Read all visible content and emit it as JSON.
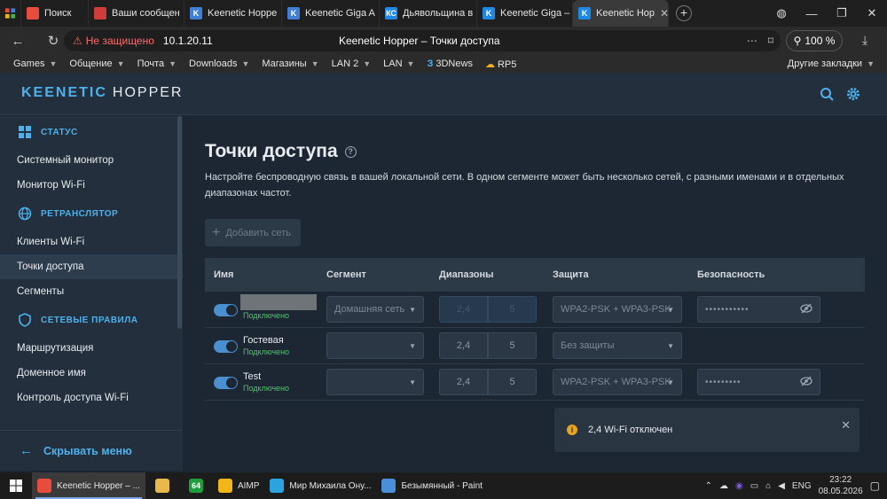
{
  "browser": {
    "tabs": [
      {
        "label": "Поиск",
        "icon": "yandex-icon",
        "color": "#e84c3d"
      },
      {
        "label": "Ваши сообщен",
        "icon": "forum-icon",
        "color": "#d03b3b"
      },
      {
        "label": "Keenetic Hoppe",
        "icon": "keenetic-icon",
        "color": "#3f7fd6"
      },
      {
        "label": "Keenetic Giga A",
        "icon": "keenetic-icon",
        "color": "#3f7fd6"
      },
      {
        "label": "Дьявольщина в",
        "icon": "kc-icon",
        "color": "#1e88e5"
      },
      {
        "label": "Keenetic Giga –",
        "icon": "keenetic-k-icon",
        "color": "#1e88e5"
      },
      {
        "label": "Keenetic Hop",
        "icon": "keenetic-k-icon",
        "color": "#1e88e5",
        "active": true
      }
    ],
    "address": {
      "security": "Не защищено",
      "host": "10.1.20.11",
      "page_title": "Keenetic Hopper – Точки доступа",
      "zoom": "100 %"
    },
    "bookmarks": [
      {
        "label": "Games",
        "menu": true
      },
      {
        "label": "Общение",
        "menu": true
      },
      {
        "label": "Почта",
        "menu": true
      },
      {
        "label": "Downloads",
        "menu": true
      },
      {
        "label": "Магазины",
        "menu": true
      },
      {
        "label": "LAN 2",
        "menu": true
      },
      {
        "label": "LAN",
        "menu": true
      },
      {
        "label": "3DNews",
        "menu": false
      },
      {
        "label": "RP5",
        "menu": false
      }
    ],
    "bookmarks_other": "Другие закладки"
  },
  "app": {
    "logo_main": "KEENETIC",
    "logo_sub": "HOPPER",
    "accent": "#4db2ec"
  },
  "sidebar": {
    "sections": [
      {
        "title": "СТАТУС",
        "icon": "status-grid-icon",
        "items": [
          "Системный монитор",
          "Монитор Wi-Fi"
        ]
      },
      {
        "title": "РЕТРАНСЛЯТОР",
        "icon": "globe-icon",
        "items": [
          "Клиенты Wi-Fi",
          "Точки доступа",
          "Сегменты"
        ]
      },
      {
        "title": "СЕТЕВЫЕ ПРАВИЛА",
        "icon": "shield-icon",
        "items": [
          "Маршрутизация",
          "Доменное имя",
          "Контроль доступа Wi-Fi"
        ]
      }
    ],
    "active_item": "Точки доступа",
    "hide_menu": "Скрывать меню"
  },
  "main": {
    "title": "Точки доступа",
    "description": "Настройте беспроводную связь в вашей локальной сети. В одном сегменте может быть несколько сетей, с разными именами и в отдельных диапазонах частот.",
    "add_button": "Добавить сеть",
    "columns": [
      "Имя",
      "Сегмент",
      "Диапазоны",
      "Защита",
      "Безопасность"
    ],
    "rows": [
      {
        "name": "",
        "status": "Подключено",
        "segment": "Домашняя сеть",
        "band1": "2,4",
        "band2": "5",
        "security": "WPA2-PSK + WPA3-PSK",
        "password": "•••••••••••",
        "bands_active": true,
        "has_password": true
      },
      {
        "name": "Гостевая",
        "status": "Подключено",
        "segment": "",
        "band1": "2,4",
        "band2": "5",
        "security": "Без защиты",
        "password": "",
        "bands_active": false,
        "has_password": false
      },
      {
        "name": "Test",
        "status": "Подключено",
        "segment": "",
        "band1": "2,4",
        "band2": "5",
        "security": "WPA2-PSK + WPA3-PSK",
        "password": "•••••••••",
        "bands_active": false,
        "has_password": true
      }
    ]
  },
  "toast": {
    "message": "2,4 Wi-Fi отключен"
  },
  "taskbar": {
    "items": [
      {
        "label": "Keenetic Hopper – ...",
        "icon": "yandex-browser-icon",
        "color": "#e84c3d",
        "active": true
      },
      {
        "label": "",
        "icon": "folder-icon",
        "color": "#e8b84a"
      },
      {
        "label": "",
        "icon": "app-64-icon",
        "color": "#1f9d3c",
        "text": "64"
      },
      {
        "label": "AIMP",
        "icon": "aimp-icon",
        "color": "#f2b619"
      },
      {
        "label": "Мир Михаила Ону...",
        "icon": "telegram-icon",
        "color": "#2aa3de"
      },
      {
        "label": "Безымянный - Paint",
        "icon": "paint-icon",
        "color": "#4a90d9"
      }
    ],
    "lang": "ENG",
    "time": "23:22",
    "date": "08.05.2026"
  }
}
